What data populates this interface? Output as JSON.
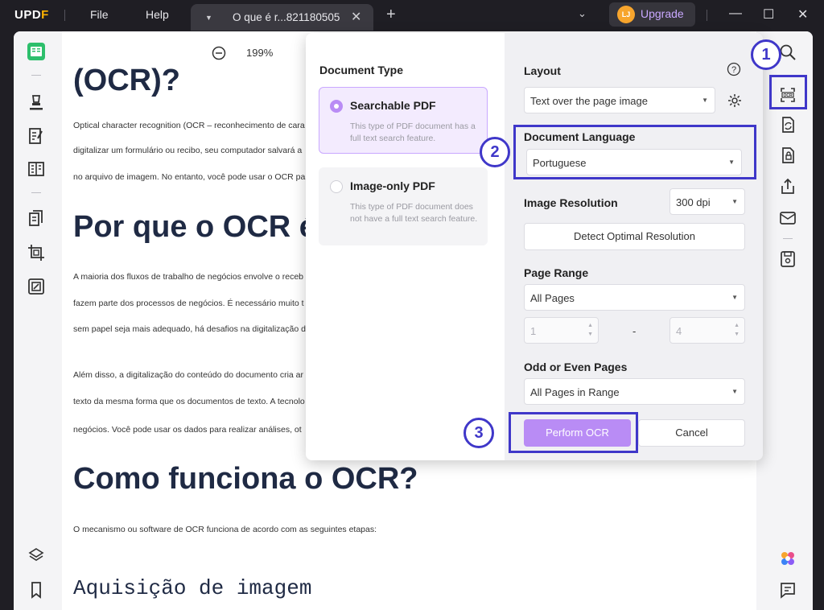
{
  "titlebar": {
    "logo": "UPDF",
    "menu": [
      "File",
      "Help"
    ],
    "tab_title": "O que é r...821180505",
    "avatar_initials": "LJ",
    "upgrade_label": "Upgrade"
  },
  "toolbar": {
    "zoom_value": "199%"
  },
  "document": {
    "heading_partial": "(OCR)?",
    "para1": [
      "Optical character recognition (OCR – reconhecimento de cara",
      "digitalizar um formulário ou recibo, seu computador salvará a",
      "no arquivo de imagem. No entanto, você pode usar o OCR pa"
    ],
    "heading2": "Por que o OCR é",
    "para2": [
      "A maioria dos fluxos de trabalho de negócios envolve o receb",
      "fazem parte dos processos de negócios. É necessário muito t",
      "sem papel seja mais adequado, há desafios na digitalização d"
    ],
    "para3": [
      "Além disso, a digitalização do conteúdo do documento cria ar",
      "texto da mesma forma que os documentos de texto. A tecnolo",
      "negócios. Você pode usar os dados para realizar análises, ot"
    ],
    "heading3": "Como funciona o OCR?",
    "para4": "O mecanismo ou software de OCR funciona de acordo com as seguintes etapas:",
    "heading4": "Aquisição de imagem"
  },
  "dialog": {
    "document_type_label": "Document Type",
    "options": [
      {
        "title": "Searchable PDF",
        "desc": "This type of PDF document has a full text search feature.",
        "selected": true
      },
      {
        "title": "Image-only PDF",
        "desc": "This type of PDF document does not have a full text search feature.",
        "selected": false
      }
    ],
    "layout_label": "Layout",
    "layout_value": "Text over the page image",
    "language_label": "Document Language",
    "language_value": "Portuguese",
    "resolution_label": "Image Resolution",
    "resolution_value": "300 dpi",
    "detect_button": "Detect Optimal Resolution",
    "page_range_label": "Page Range",
    "page_range_value": "All Pages",
    "range_from": "1",
    "range_dash": "-",
    "range_to": "4",
    "odd_even_label": "Odd or Even Pages",
    "odd_even_value": "All Pages in Range",
    "perform_button": "Perform OCR",
    "cancel_button": "Cancel"
  },
  "annotations": [
    "1",
    "2",
    "3"
  ],
  "colors": {
    "accent": "#b98cf5",
    "annotation": "#3f37c9",
    "selected_card_bg": "#f3ebfe",
    "logo_accent": "#ffb400"
  }
}
